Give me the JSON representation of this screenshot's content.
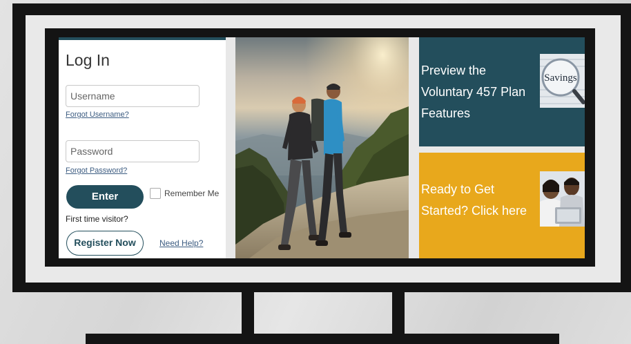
{
  "login": {
    "title": "Log In",
    "username_placeholder": "Username",
    "forgot_username": "Forgot Username?",
    "password_placeholder": "Password",
    "forgot_password": "Forgot Password?",
    "enter_label": "Enter",
    "remember_label": "Remember Me",
    "first_time": "First time visitor?",
    "register_label": "Register Now",
    "help_label": "Need Help?"
  },
  "promos": {
    "preview_text": "Preview the Voluntary 457 Plan Features",
    "preview_image_text": "Savings",
    "started_text": "Ready to Get Started? Click here"
  },
  "colors": {
    "brand_teal": "#234e5c",
    "promo_gold": "#e8a81c"
  }
}
